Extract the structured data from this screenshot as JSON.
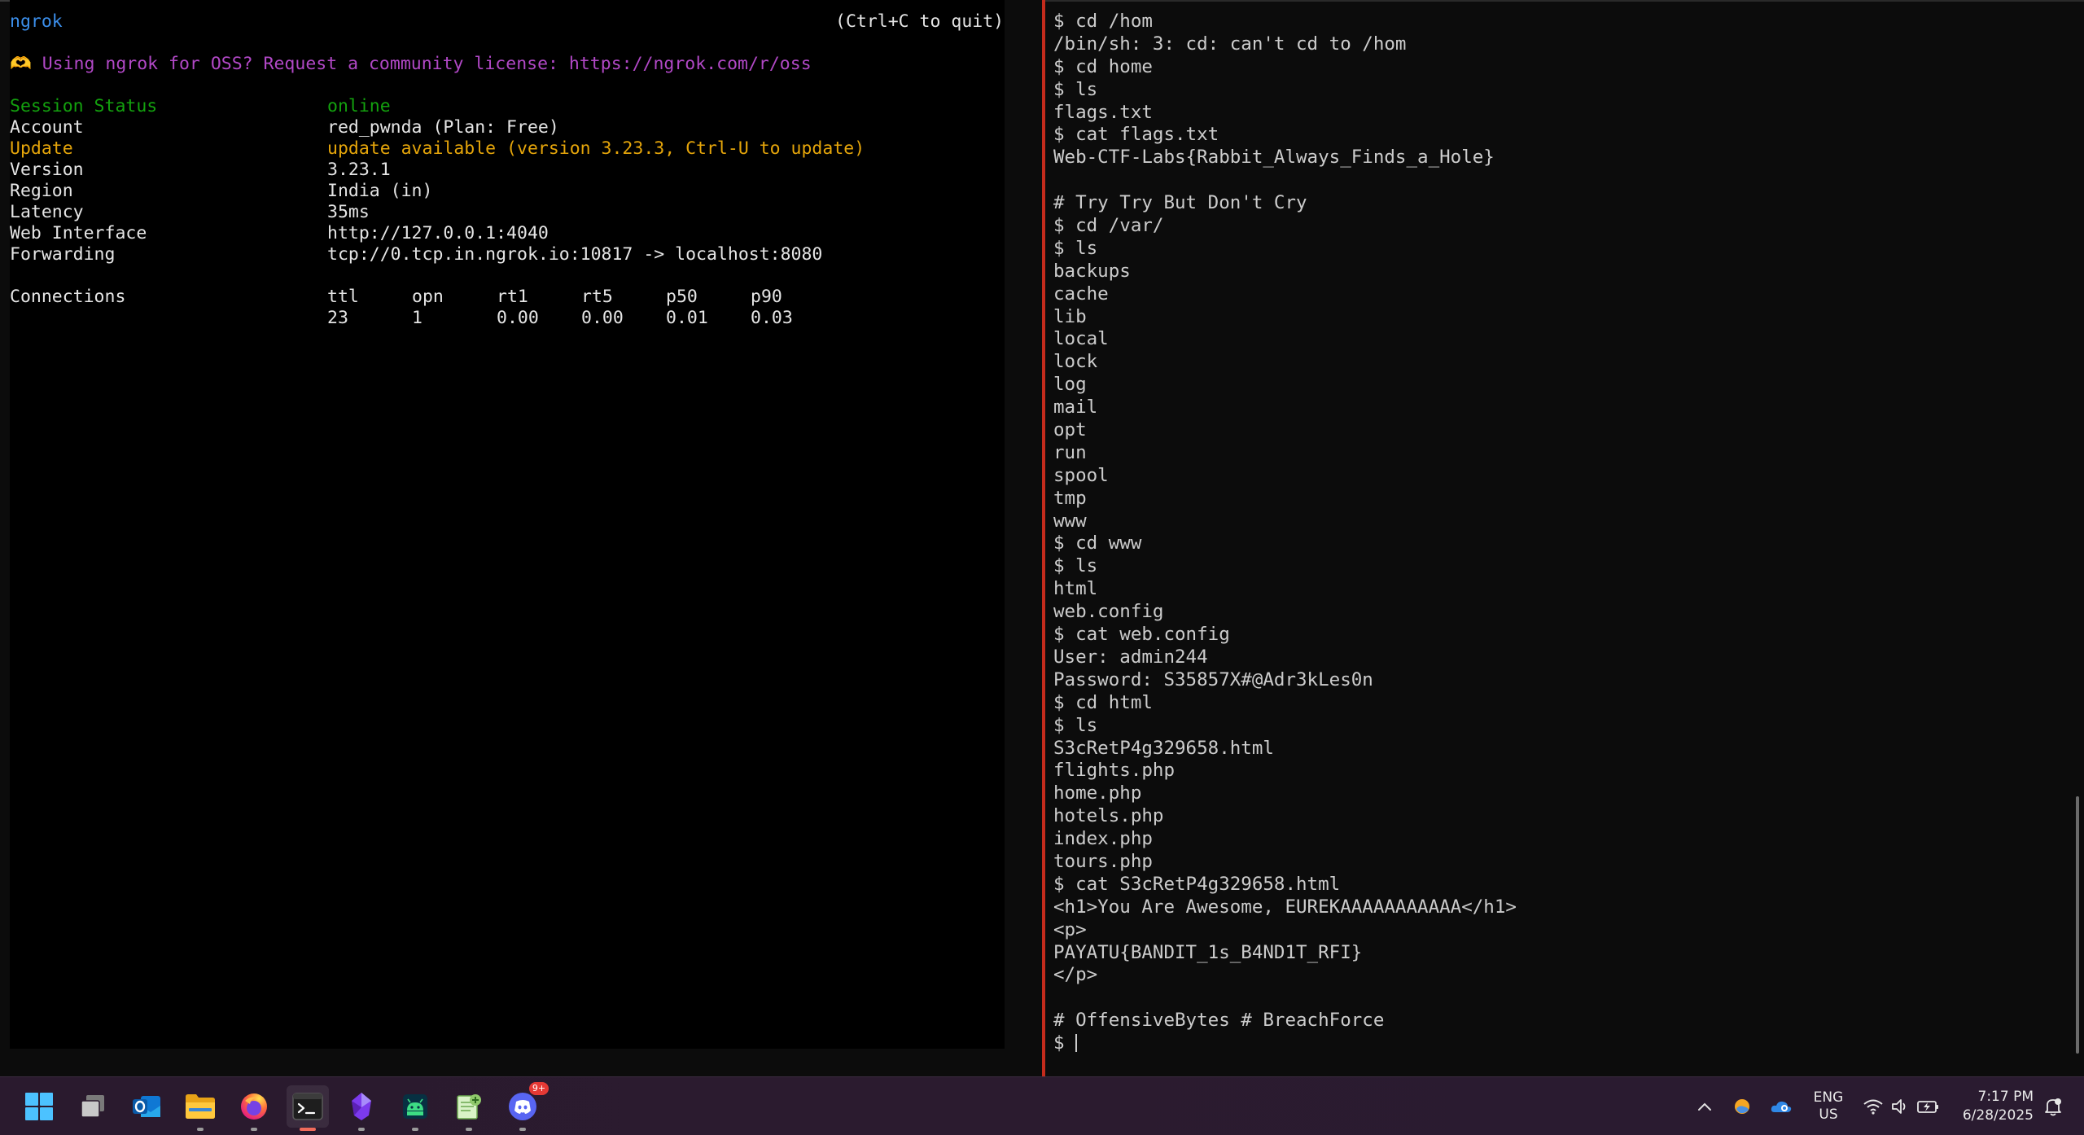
{
  "ngrok": {
    "title": "ngrok",
    "quit_hint": "(Ctrl+C to quit)",
    "notice": "🫶 Using ngrok for OSS? Request a community license: https://ngrok.com/r/oss",
    "rows": [
      {
        "key": "Session Status",
        "value": "online"
      },
      {
        "key": "Account",
        "value": "red_pwnda (Plan: Free)"
      },
      {
        "key": "Update",
        "value": "update available (version 3.23.3, Ctrl-U to update)"
      },
      {
        "key": "Version",
        "value": "3.23.1"
      },
      {
        "key": "Region",
        "value": "India (in)"
      },
      {
        "key": "Latency",
        "value": "35ms"
      },
      {
        "key": "Web Interface",
        "value": "http://127.0.0.1:4040"
      },
      {
        "key": "Forwarding",
        "value": "tcp://0.tcp.in.ngrok.io:10817 -> localhost:8080"
      }
    ],
    "connections": {
      "label": "Connections",
      "headers": [
        "ttl",
        "opn",
        "rt1",
        "rt5",
        "p50",
        "p90"
      ],
      "values": [
        "23",
        "1",
        "0.00",
        "0.00",
        "0.01",
        "0.03"
      ]
    }
  },
  "shell": {
    "lines": [
      "$ cd /hom",
      "/bin/sh: 3: cd: can't cd to /hom",
      "$ cd home",
      "$ ls",
      "flags.txt",
      "$ cat flags.txt",
      "Web-CTF-Labs{Rabbit_Always_Finds_a_Hole}",
      "",
      "# Try Try But Don't Cry",
      "$ cd /var/",
      "$ ls",
      "backups",
      "cache",
      "lib",
      "local",
      "lock",
      "log",
      "mail",
      "opt",
      "run",
      "spool",
      "tmp",
      "www",
      "$ cd www",
      "$ ls",
      "html",
      "web.config",
      "$ cat web.config",
      "User: admin244",
      "Password: S35857X#@Adr3kLes0n",
      "$ cd html",
      "$ ls",
      "S3cRetP4g329658.html",
      "flights.php",
      "home.php",
      "hotels.php",
      "index.php",
      "tours.php",
      "$ cat S3cRetP4g329658.html",
      "<h1>You Are Awesome, EUREKAAAAAAAAAAA</h1>",
      "<p>",
      "PAYATU{BANDIT_1s_B4ND1T_RFI}",
      "</p>",
      "",
      "# OffensiveBytes # BreachForce"
    ],
    "prompt": "$ "
  },
  "taskbar": {
    "apps": [
      {
        "name": "start",
        "icon": "windows-logo-icon"
      },
      {
        "name": "task-view",
        "icon": "task-view-icon"
      },
      {
        "name": "outlook",
        "icon": "outlook-icon"
      },
      {
        "name": "file-explorer",
        "icon": "folder-icon"
      },
      {
        "name": "firefox",
        "icon": "firefox-icon"
      },
      {
        "name": "terminal",
        "icon": "terminal-icon"
      },
      {
        "name": "obsidian",
        "icon": "obsidian-icon"
      },
      {
        "name": "android-studio",
        "icon": "android-icon"
      },
      {
        "name": "notepad-plus",
        "icon": "notepad-icon"
      },
      {
        "name": "discord",
        "icon": "discord-icon"
      }
    ],
    "discord_badge": "9+",
    "language": {
      "line1": "ENG",
      "line2": "US"
    },
    "clock": {
      "time": "7:17 PM",
      "date": "6/28/2025"
    },
    "colors": {
      "accent_active": "#f26b5b",
      "divider": "#c42b1c"
    }
  }
}
